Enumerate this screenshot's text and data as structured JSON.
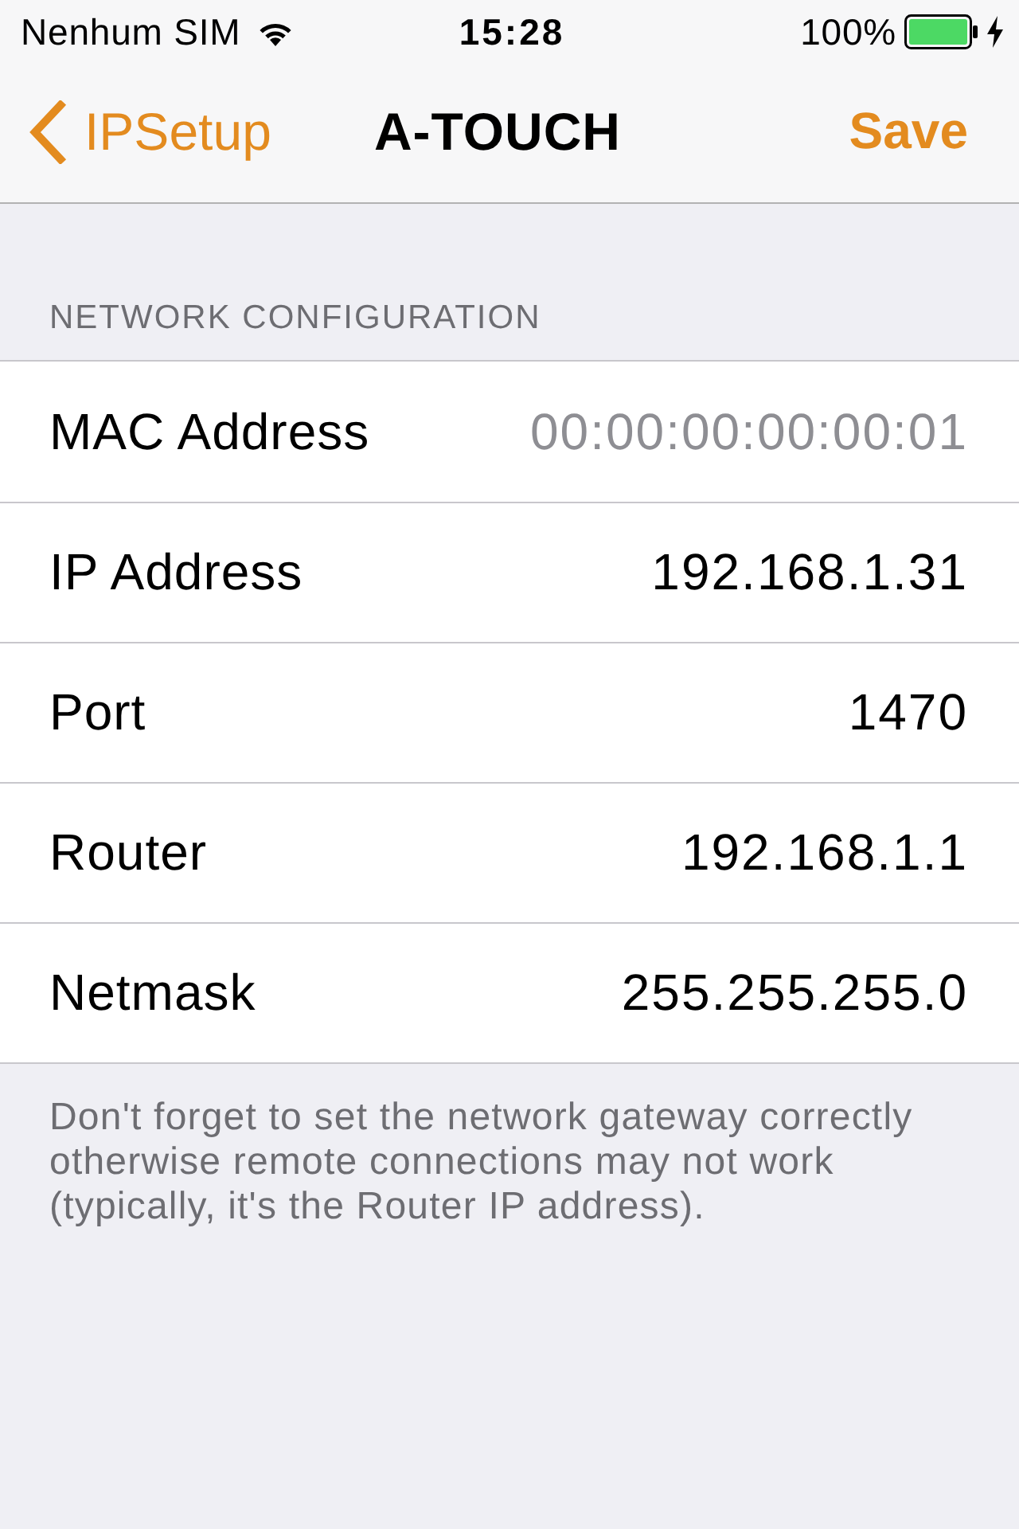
{
  "status_bar": {
    "carrier": "Nenhum SIM",
    "time": "15:28",
    "battery": "100%",
    "charging": true
  },
  "nav_bar": {
    "back": "IPSetup",
    "title": "A-TOUCH",
    "action": "Save"
  },
  "section": {
    "header": "NETWORK CONFIGURATION",
    "rows": [
      {
        "label": "MAC Address",
        "value": "00:00:00:00:00:01",
        "disabled": true
      },
      {
        "label": "IP Address",
        "value": "192.168.1.31",
        "disabled": false
      },
      {
        "label": "Port",
        "value": "1470",
        "disabled": false
      },
      {
        "label": "Router",
        "value": "192.168.1.1",
        "disabled": false
      },
      {
        "label": "Netmask",
        "value": "255.255.255.0",
        "disabled": false
      }
    ],
    "footer": "Don't forget to set the network gateway correctly otherwise remote connections may not work (typically, it's the Router IP address)."
  }
}
